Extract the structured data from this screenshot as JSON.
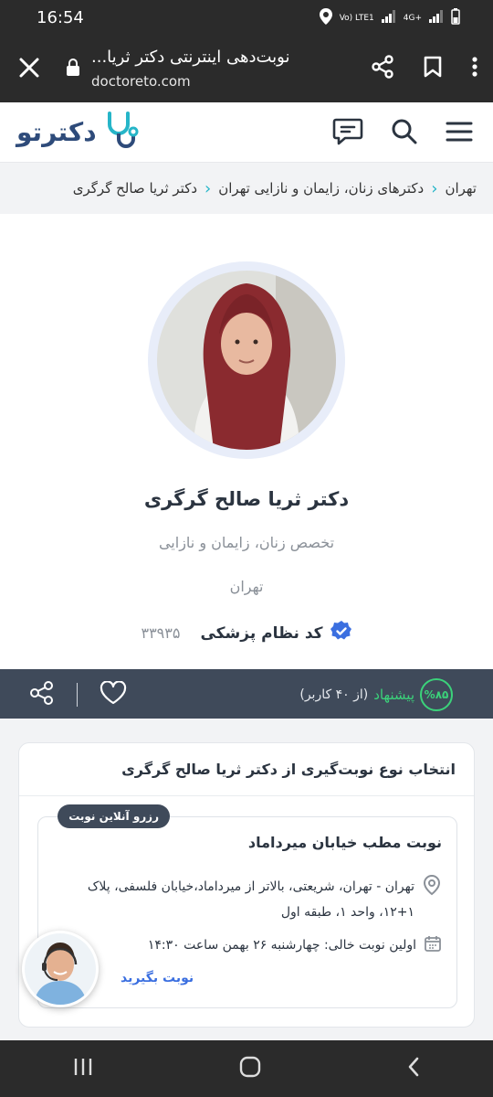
{
  "status_bar": {
    "time": "16:54",
    "network": "Vo) LTE1",
    "signal_4g": "4G+"
  },
  "browser": {
    "title": "نوبت‌دهی اینترنتی دکتر ثریا...",
    "url": "doctoreto.com"
  },
  "site": {
    "logo_text": "دکترتو"
  },
  "breadcrumb": {
    "items": [
      "تهران",
      "دکترهای زنان، زایمان و نازایی تهران",
      "دکتر ثریا صالح گرگری"
    ]
  },
  "profile": {
    "name": "دکتر ثریا صالح گرگری",
    "specialty": "تخصص زنان، زایمان و نازایی",
    "city": "تهران",
    "medical_code_label": "کد نظام پزشکی",
    "medical_code": "۳۳۹۳۵"
  },
  "rating": {
    "percent": "%۸۵",
    "word": "پیشنهاد",
    "count_text": "(از ۴۰ کاربر)",
    "recommendation_fraction": 0.85
  },
  "booking": {
    "header": "انتخاب نوع نوبت‌گیری از دکتر ثریا صالح گرگری",
    "pill": "رزرو آنلاین نوبت",
    "office_title": "نوبت مطب خیابان میرداماد",
    "address": "تهران - تهران، شریعتی، بالاتر از میرداماد،خیابان فلسفی، پلاک ۱+۱۲، واحد ۱، طبقه اول",
    "first_slot": "اولین نوبت خالی: چهارشنبه ۲۶ بهمن ساعت ۱۴:۳۰",
    "book_label": "نوبت بگیرید"
  },
  "colors": {
    "brand_navy": "#2e4b7a",
    "brand_teal": "#26b5c8",
    "action_bar": "#3f4a5a",
    "recommend_green": "#3bd27a",
    "link_blue": "#3b6fe0"
  }
}
